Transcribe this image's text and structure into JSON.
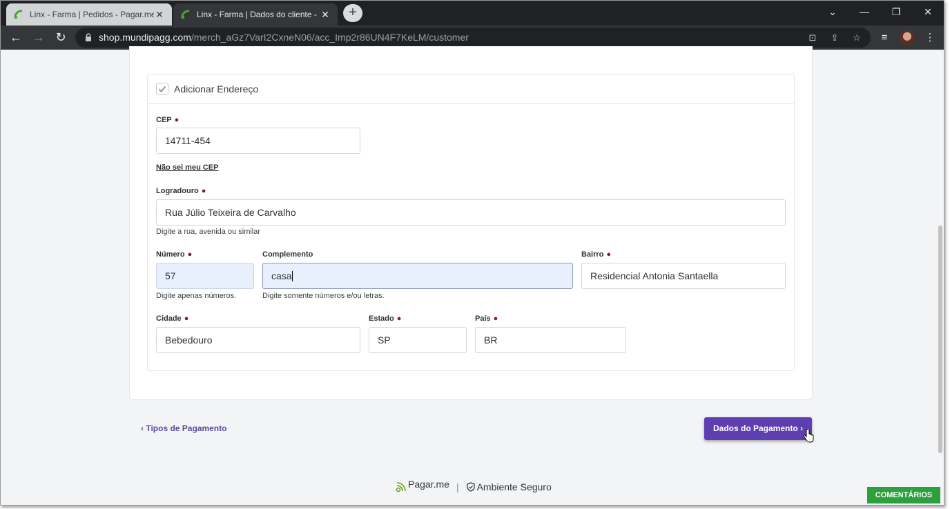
{
  "browser": {
    "tabs": [
      {
        "title": "Linx - Farma | Pedidos - Pagar.me",
        "close": "✕"
      },
      {
        "title": "Linx - Farma | Dados do cliente - ",
        "close": "✕"
      }
    ],
    "new_tab": "+",
    "url_host": "shop.mundipagg.com",
    "url_path": "/merch_aGz7VarI2CxneN06/acc_Imp2r86UN4F7KeLM/customer"
  },
  "form": {
    "add_address_label": "Adicionar Endereço",
    "add_address_checked": true,
    "required_marker": "●",
    "cep": {
      "label": "CEP",
      "value": "14711-454",
      "help_link": "Não sei meu CEP"
    },
    "logradouro": {
      "label": "Logradouro",
      "value": "Rua Júlio Teixeira de Carvalho",
      "hint": "Digite a rua, avenida ou similar"
    },
    "numero": {
      "label": "Número",
      "value": "57",
      "hint": "Digite apenas números."
    },
    "complemento": {
      "label": "Complemento",
      "value": "casa",
      "hint": "Digite somente números e/ou letras."
    },
    "bairro": {
      "label": "Bairro",
      "value": "Residencial Antonia Santaella"
    },
    "cidade": {
      "label": "Cidade",
      "value": "Bebedouro"
    },
    "estado": {
      "label": "Estado",
      "value": "SP"
    },
    "pais": {
      "label": "País",
      "value": "BR"
    }
  },
  "nav": {
    "back_label": "‹ Tipos de Pagamento",
    "next_label": "Dados do Pagamento ›"
  },
  "footer": {
    "brand": "Pagar.me",
    "separator": "|",
    "secure": "Ambiente Seguro",
    "comments": "COMENTÁRIOS"
  },
  "colors": {
    "primary": "#5e3fb0",
    "required": "#8b1a2b",
    "comments": "#2e9f3e"
  }
}
